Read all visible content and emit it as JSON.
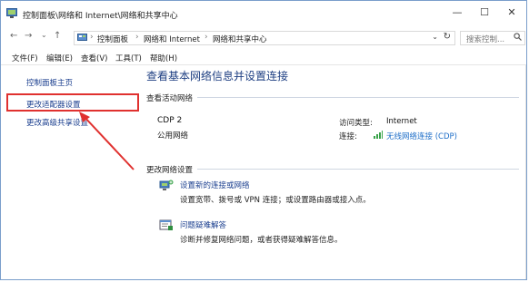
{
  "window": {
    "title": "控制面板\\网络和 Internet\\网络和共享中心",
    "minimize": "—",
    "maximize": "☐",
    "close": "✕",
    "help": "?"
  },
  "nav": {
    "back": "←",
    "forward": "→",
    "recent": "⌄",
    "up": "↑",
    "breadcrumb": [
      "控制面板",
      "网络和 Internet",
      "网络和共享中心"
    ],
    "separator": "›",
    "dropdown": "⌄",
    "refresh": "↻"
  },
  "search": {
    "placeholder": "搜索控制...",
    "icon": "search-icon"
  },
  "menu": [
    "文件(F)",
    "编辑(E)",
    "查看(V)",
    "工具(T)",
    "帮助(H)"
  ],
  "left_pane": {
    "items": [
      "控制面板主页",
      "更改适配器设置",
      "更改高级共享设置"
    ]
  },
  "main": {
    "title": "查看基本网络信息并设置连接",
    "active_section": "查看活动网络",
    "network": {
      "name": "CDP  2",
      "type": "公用网络",
      "access_label": "访问类型:",
      "access_value": "Internet",
      "conn_label": "连接:",
      "conn_value": "无线网络连接 (CDP)"
    },
    "change_section": "更改网络设置",
    "tasks": [
      {
        "title": "设置新的连接或网络",
        "desc": "设置宽带、拨号或 VPN 连接；或设置路由器或接入点。"
      },
      {
        "title": "问题疑难解答",
        "desc": "诊断并修复网络问题，或者获得疑难解答信息。"
      }
    ]
  },
  "colors": {
    "highlight": "#e0312f",
    "link": "#1b3f8f",
    "accent": "#1e6ec8"
  }
}
